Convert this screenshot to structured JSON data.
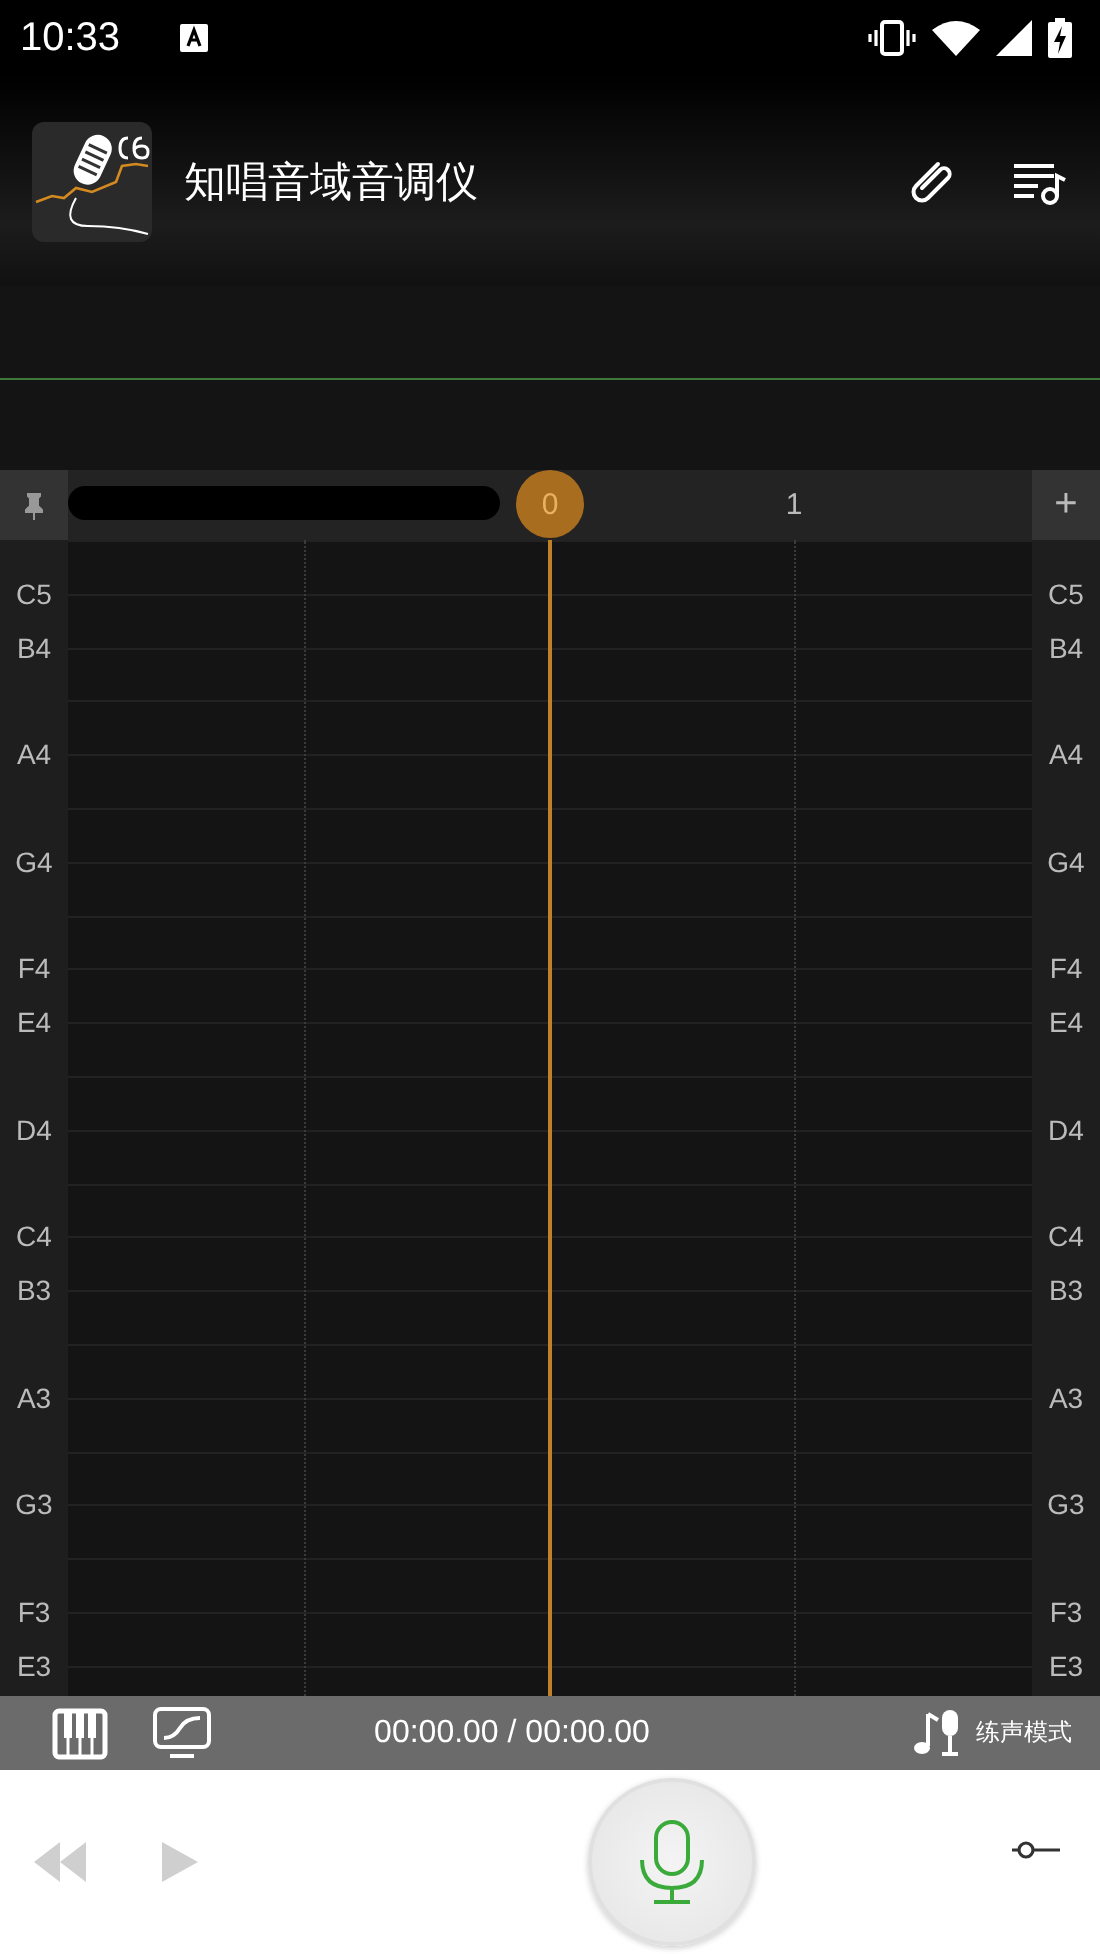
{
  "status_bar": {
    "time": "10:33"
  },
  "app_bar": {
    "title": "知唱音域音调仪"
  },
  "timeline": {
    "add_label": "+",
    "markers": [
      {
        "label": "0",
        "selected": true
      },
      {
        "label": "1",
        "selected": false
      }
    ]
  },
  "pitch_rows": [
    {
      "left": "C5",
      "right": "C5"
    },
    {
      "left": "B4",
      "right": "B4"
    },
    {
      "left": "A4",
      "right": "A4"
    },
    {
      "left": "G4",
      "right": "G4"
    },
    {
      "left": "F4",
      "right": "F4"
    },
    {
      "left": "E4",
      "right": "E4"
    },
    {
      "left": "D4",
      "right": "D4"
    },
    {
      "left": "C4",
      "right": "C4"
    },
    {
      "left": "B3",
      "right": "B3"
    },
    {
      "left": "A3",
      "right": "A3"
    },
    {
      "left": "G3",
      "right": "G3"
    },
    {
      "left": "F3",
      "right": "F3"
    },
    {
      "left": "E3",
      "right": "E3"
    }
  ],
  "toolbar": {
    "time": "00:00.00 / 00:00.00",
    "mode_label": "练声模式"
  },
  "transport": {
    "rewind": {
      "disabled": true
    },
    "play": {
      "disabled": true
    }
  }
}
